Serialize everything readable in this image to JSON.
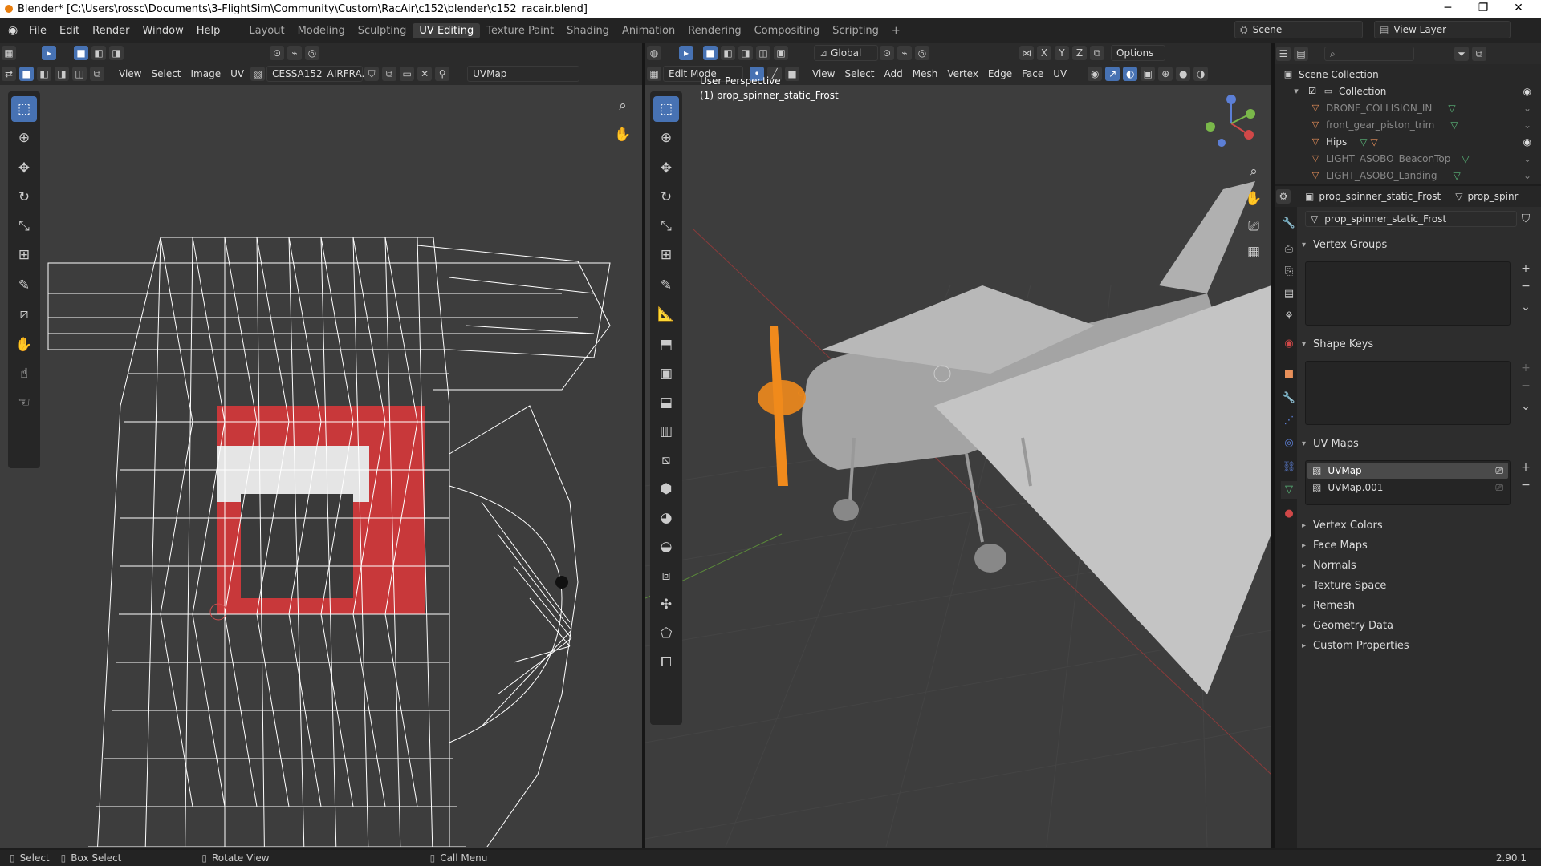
{
  "window": {
    "title": "Blender* [C:\\Users\\rossc\\Documents\\3-FlightSim\\Community\\Custom\\RacAir\\c152\\blender\\c152_racair.blend]",
    "minimize": "─",
    "restore": "❐",
    "close": "✕"
  },
  "menu": {
    "file": "File",
    "edit": "Edit",
    "render": "Render",
    "window": "Window",
    "help": "Help"
  },
  "workspaces": [
    "Layout",
    "Modeling",
    "Sculpting",
    "UV Editing",
    "Texture Paint",
    "Shading",
    "Animation",
    "Rendering",
    "Compositing",
    "Scripting"
  ],
  "workspace_add": "+",
  "scene": {
    "label": "Scene",
    "view_layer": "View Layer"
  },
  "uv_editor": {
    "menus": [
      "View",
      "Select",
      "Image",
      "UV"
    ],
    "image_name": "CESSA152_AIRFRA...",
    "uv_map": "UVMap"
  },
  "viewport": {
    "transform": "Global",
    "mode": "Edit Mode",
    "menus": [
      "View",
      "Select",
      "Add",
      "Mesh",
      "Vertex",
      "Edge",
      "Face",
      "UV"
    ],
    "options": "Options",
    "perspective": "User Perspective",
    "object": "(1) prop_spinner_static_Frost",
    "axes": {
      "x": "X",
      "y": "Y",
      "z": "Z"
    }
  },
  "outliner": {
    "root": "Scene Collection",
    "collection": "Collection",
    "items": [
      "DRONE_COLLISION_IN",
      "front_gear_piston_trim",
      "Hips",
      "LIGHT_ASOBO_BeaconTop",
      "LIGHT_ASOBO_Landing"
    ]
  },
  "properties": {
    "object_name": "prop_spinner_static_Frost",
    "data_tab_name": "prop_spinr",
    "mesh_name": "prop_spinner_static_Frost",
    "panels": {
      "vertex_groups": "Vertex Groups",
      "shape_keys": "Shape Keys",
      "uv_maps": "UV Maps"
    },
    "uv_maps": [
      "UVMap",
      "UVMap.001"
    ],
    "collapsed": [
      "Vertex Colors",
      "Face Maps",
      "Normals",
      "Texture Space",
      "Remesh",
      "Geometry Data",
      "Custom Properties"
    ]
  },
  "status": {
    "select": "Select",
    "box_select": "Box Select",
    "rotate": "Rotate View",
    "call_menu": "Call Menu",
    "version": "2.90.1"
  },
  "colors": {
    "accent": "#4772b3",
    "selection": "#f08a1c",
    "bg": "#3d3d3d"
  }
}
